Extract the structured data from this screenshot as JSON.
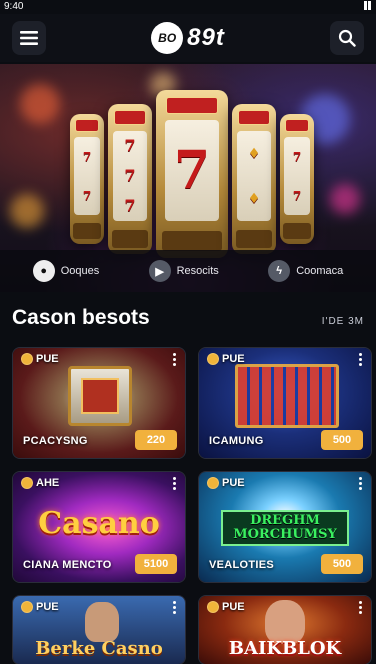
{
  "status": {
    "time": "9:40"
  },
  "header": {
    "logo_badge": "BO",
    "logo_text": "89t"
  },
  "hero": {
    "links": [
      {
        "label": "Ooques",
        "icon": "chip-icon"
      },
      {
        "label": "Resocits",
        "icon": "play-icon"
      },
      {
        "label": "Coomaca",
        "icon": "bolt-icon"
      }
    ],
    "symbols": [
      "7",
      "7",
      "7"
    ]
  },
  "section": {
    "title": "Cason besots",
    "more": "I'DE 3M"
  },
  "games": [
    {
      "tag": "PUE",
      "name": "PCACYSNG",
      "bet": "220"
    },
    {
      "tag": "PUE",
      "name": "ICAMUNG",
      "bet": "500"
    },
    {
      "tag": "AHE",
      "name": "CIANA MENCTO",
      "bet": "5100",
      "art_title": "Casano"
    },
    {
      "tag": "PUE",
      "name": "VEALOTIES",
      "bet": "500",
      "art_title": "DREGHM MORCHUMSY"
    },
    {
      "tag": "PUE",
      "name": "",
      "bet": "",
      "art_title": "Berke Casno"
    },
    {
      "tag": "PUE",
      "name": "",
      "bet": "",
      "art_title": "BAIKBLOK"
    }
  ]
}
